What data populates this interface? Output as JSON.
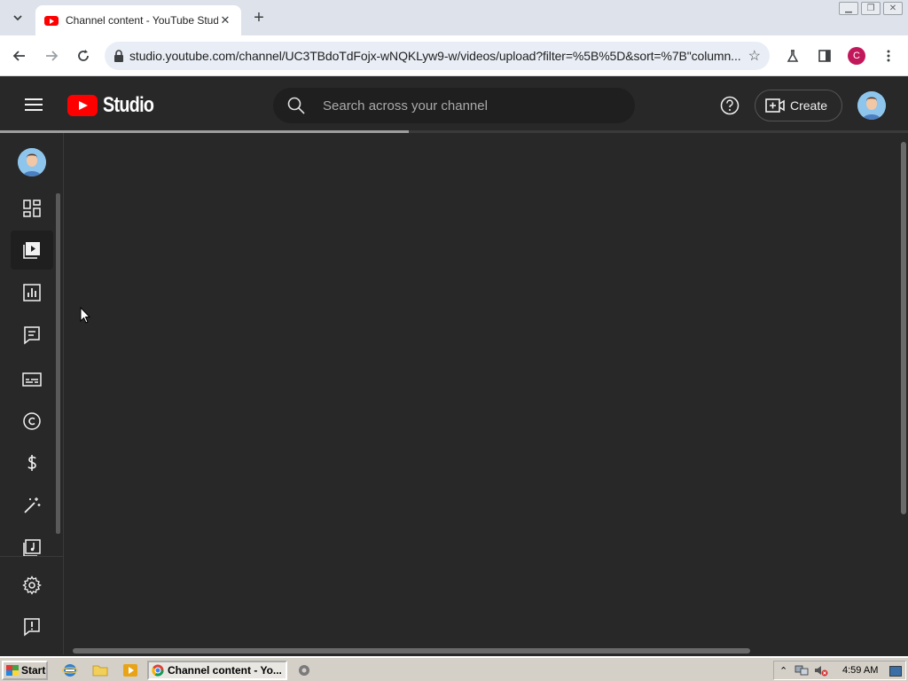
{
  "browser": {
    "tab_title": "Channel content - YouTube Studio",
    "tab_close": "✕",
    "new_tab": "+",
    "url": "studio.youtube.com/channel/UC3TBdoTdFojx-wNQKLyw9-w/videos/upload?filter=%5B%5D&sort=%7B\"column...",
    "profile_initial": "C"
  },
  "studio": {
    "logo_text": "Studio",
    "search_placeholder": "Search across your channel",
    "create_label": "Create",
    "loading_progress": 0.45
  },
  "sidenav": {
    "items": [
      {
        "name": "dashboard",
        "icon": "dashboard-icon",
        "active": false
      },
      {
        "name": "content",
        "icon": "content-icon",
        "active": true
      },
      {
        "name": "analytics",
        "icon": "analytics-icon",
        "active": false
      },
      {
        "name": "comments",
        "icon": "comments-icon",
        "active": false
      },
      {
        "name": "subtitles",
        "icon": "subtitles-icon",
        "active": false
      },
      {
        "name": "copyright",
        "icon": "copyright-icon",
        "active": false
      },
      {
        "name": "earn",
        "icon": "dollar-icon",
        "active": false
      },
      {
        "name": "customization",
        "icon": "magic-wand-icon",
        "active": false
      },
      {
        "name": "audio-library",
        "icon": "audio-library-icon",
        "active": false
      }
    ],
    "bottom_items": [
      {
        "name": "settings",
        "icon": "gear-icon"
      },
      {
        "name": "send-feedback",
        "icon": "feedback-icon"
      }
    ]
  },
  "taskbar": {
    "start_label": "Start",
    "active_window": "Channel content - Yo...",
    "clock": "4:59 AM"
  },
  "colors": {
    "background": "#282828",
    "youtube_red": "#ff0000",
    "text": "#f1f1f1"
  }
}
